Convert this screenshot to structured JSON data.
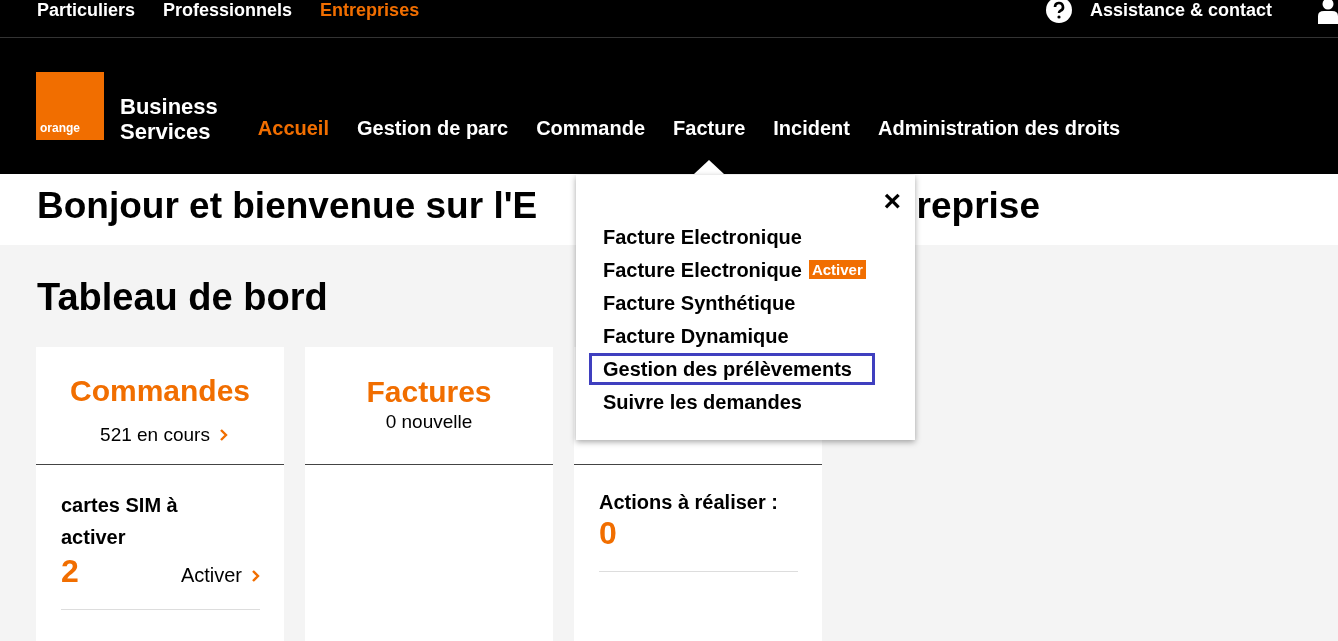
{
  "top_bar": {
    "links": [
      {
        "label": "Particuliers",
        "selected": false
      },
      {
        "label": "Professionnels",
        "selected": false
      },
      {
        "label": "Entreprises",
        "selected": true
      }
    ],
    "help": "Assistance & contact"
  },
  "header": {
    "logo_text": "orange",
    "brand": [
      "Business",
      "Services"
    ],
    "nav": [
      {
        "label": "Accueil",
        "selected": true,
        "expanded": false
      },
      {
        "label": "Gestion de parc",
        "selected": false,
        "expanded": false
      },
      {
        "label": "Commande",
        "selected": false,
        "expanded": false
      },
      {
        "label": "Facture",
        "selected": false,
        "expanded": true
      },
      {
        "label": "Incident",
        "selected": false,
        "expanded": false
      },
      {
        "label": "Administration des droits",
        "selected": false,
        "expanded": false
      }
    ]
  },
  "welcome": {
    "title_parts": [
      "Bonjour et bienvenue sur l'E",
      "reprise"
    ]
  },
  "dashboard": {
    "title": "Tableau de bord",
    "cards": [
      {
        "title": "Commandes",
        "subtitle": "521 en cours",
        "has_link": true,
        "body_label": "cartes SIM à activer",
        "body_value": "2",
        "body_action": "Activer"
      },
      {
        "title": "Factures",
        "subtitle": "0 nouvelle",
        "has_link": false
      },
      {
        "body_label": "Actions à réaliser :",
        "body_value": "0"
      }
    ]
  },
  "dropdown": {
    "close": "×",
    "items": [
      {
        "label": "Facture Electronique",
        "highlighted": false
      },
      {
        "label": "Facture Electronique",
        "badge": "Activer",
        "highlighted": false
      },
      {
        "label": "Facture Synthétique",
        "highlighted": false
      },
      {
        "label": "Facture Dynamique",
        "highlighted": false
      },
      {
        "label": "Gestion des prélèvements",
        "highlighted": true
      },
      {
        "label": "Suivre les demandes",
        "highlighted": false
      }
    ]
  }
}
